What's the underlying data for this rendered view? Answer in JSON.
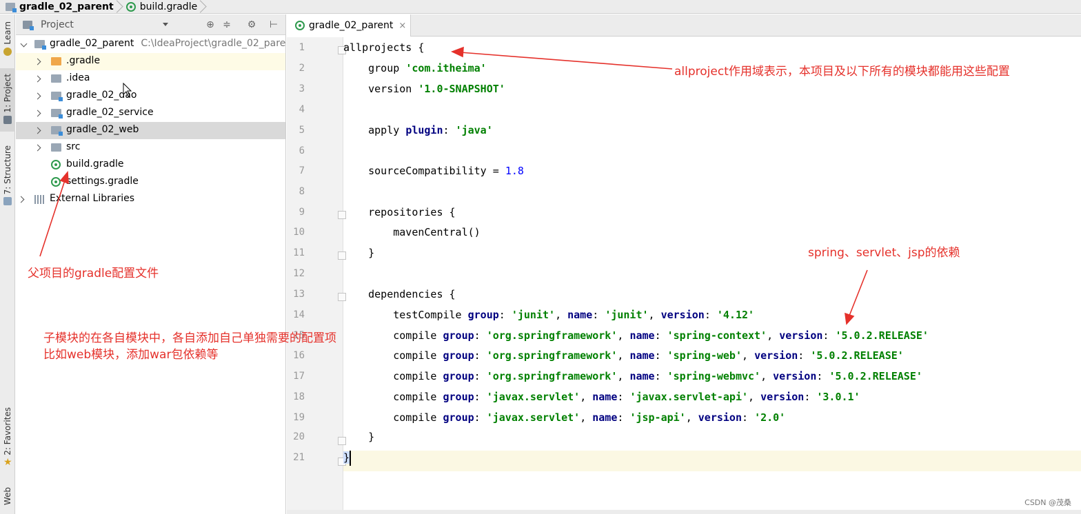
{
  "navbar": {
    "root": "gradle_02_parent",
    "file": "build.gradle"
  },
  "left_strip": {
    "learn": "Learn",
    "project": "1: Project",
    "structure": "7: Structure",
    "favorites": "2: Favorites",
    "web": "Web"
  },
  "project_panel": {
    "title": "Project",
    "root": {
      "name": "gradle_02_parent",
      "path": "C:\\IdeaProject\\gradle_02_pare"
    },
    "items": [
      {
        "name": ".gradle"
      },
      {
        "name": ".idea"
      },
      {
        "name": "gradle_02_dao"
      },
      {
        "name": "gradle_02_service"
      },
      {
        "name": "gradle_02_web"
      },
      {
        "name": "src"
      },
      {
        "name": "build.gradle"
      },
      {
        "name": "settings.gradle"
      },
      {
        "name": "External Libraries"
      }
    ]
  },
  "editor": {
    "tab": "gradle_02_parent",
    "close": "×",
    "line_numbers": [
      "1",
      "2",
      "3",
      "4",
      "5",
      "6",
      "7",
      "8",
      "9",
      "10",
      "11",
      "12",
      "13",
      "14",
      "15",
      "16",
      "17",
      "18",
      "19",
      "20",
      "21"
    ],
    "lines": {
      "l1": "allprojects {",
      "l2a": "    group ",
      "l2b": "'com.itheima'",
      "l3a": "    version ",
      "l3b": "'1.0-SNAPSHOT'",
      "l5a": "    apply ",
      "l5b": "plugin",
      "l5c": ": ",
      "l5d": "'java'",
      "l7a": "    sourceCompatibility = ",
      "l7b": "1.8",
      "l9": "    repositories {",
      "l10": "        mavenCentral()",
      "l11": "    }",
      "l13": "    dependencies {",
      "l14a": "        testCompile ",
      "l14b": "group",
      "l14c": ": ",
      "l14d": "'junit'",
      "l14e": ", ",
      "l14f": "name",
      "l14g": ": ",
      "l14h": "'junit'",
      "l14i": ", ",
      "l14j": "version",
      "l14k": ": ",
      "l14l": "'4.12'",
      "l15a": "        compile ",
      "l15b": "group",
      "l15c": ": ",
      "l15d": "'org.springframework'",
      "l15e": ", ",
      "l15f": "name",
      "l15g": ": ",
      "l15h": "'spring-context'",
      "l15i": ", ",
      "l15j": "version",
      "l15k": ": ",
      "l15l": "'5.0.2.RELEASE'",
      "l16a": "        compile ",
      "l16b": "group",
      "l16c": ": ",
      "l16d": "'org.springframework'",
      "l16e": ", ",
      "l16f": "name",
      "l16g": ": ",
      "l16h": "'spring-web'",
      "l16i": ", ",
      "l16j": "version",
      "l16k": ": ",
      "l16l": "'5.0.2.RELEASE'",
      "l17a": "        compile ",
      "l17b": "group",
      "l17c": ": ",
      "l17d": "'org.springframework'",
      "l17e": ", ",
      "l17f": "name",
      "l17g": ": ",
      "l17h": "'spring-webmvc'",
      "l17i": ", ",
      "l17j": "version",
      "l17k": ": ",
      "l17l": "'5.0.2.RELEASE'",
      "l18a": "        compile ",
      "l18b": "group",
      "l18c": ": ",
      "l18d": "'javax.servlet'",
      "l18e": ", ",
      "l18f": "name",
      "l18g": ": ",
      "l18h": "'javax.servlet-api'",
      "l18i": ", ",
      "l18j": "version",
      "l18k": ": ",
      "l18l": "'3.0.1'",
      "l19a": "        compile ",
      "l19b": "group",
      "l19c": ": ",
      "l19d": "'javax.servlet'",
      "l19e": ", ",
      "l19f": "name",
      "l19g": ": ",
      "l19h": "'jsp-api'",
      "l19i": ", ",
      "l19j": "version",
      "l19k": ": ",
      "l19l": "'2.0'",
      "l20": "    }",
      "l21": "}"
    }
  },
  "annotations": {
    "allproject": "allproject作用域表示，本项目及以下所有的模块都能用这些配置",
    "parent_config": "父项目的gradle配置文件",
    "submodule_1": "子模块的在各自模块中，各自添加自己单独需要的配置项",
    "submodule_2": "比如web模块，添加war包依赖等",
    "deps": "spring、servlet、jsp的依赖"
  },
  "watermark": "CSDN @茂桑",
  "colors": {
    "annotation": "#e5312b",
    "keyword": "#000080",
    "string": "#008000",
    "number": "#0000ff"
  }
}
